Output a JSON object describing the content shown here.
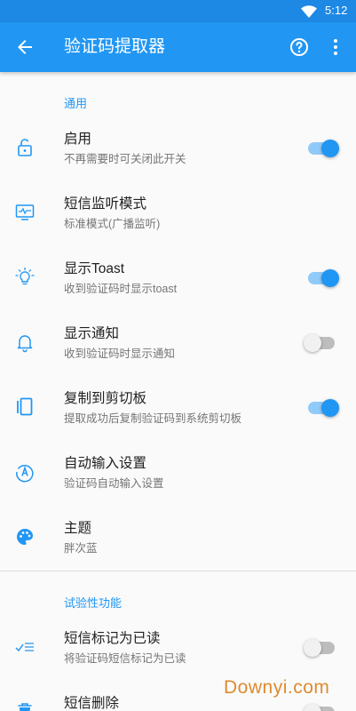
{
  "status_bar": {
    "time": "5:12",
    "wifi_icon": "wifi-icon"
  },
  "app_bar": {
    "title": "验证码提取器",
    "back_icon": "arrow-back-icon",
    "help_icon": "help-circle-icon",
    "more_icon": "more-vert-icon",
    "color": "#2196f3"
  },
  "sections": [
    {
      "header": "通用",
      "items": [
        {
          "title": "启用",
          "subtitle": "不再需要时可关闭此开关",
          "icon": "lock-open-icon",
          "switch": true
        },
        {
          "title": "短信监听模式",
          "subtitle": "标准模式(广播监听)",
          "icon": "monitor-icon"
        },
        {
          "title": "显示Toast",
          "subtitle": "收到验证码时显示toast",
          "icon": "lightbulb-icon",
          "switch": true
        },
        {
          "title": "显示通知",
          "subtitle": "收到验证码时显示通知",
          "icon": "bell-icon",
          "switch": false
        },
        {
          "title": "复制到剪切板",
          "subtitle": "提取成功后复制验证码到系统剪切板",
          "icon": "copy-icon",
          "switch": true
        },
        {
          "title": "自动输入设置",
          "subtitle": "验证码自动输入设置",
          "icon": "auto-input-icon"
        },
        {
          "title": "主题",
          "subtitle": "胖次蓝",
          "icon": "palette-icon"
        }
      ]
    },
    {
      "header": "试验性功能",
      "items": [
        {
          "title": "短信标记为已读",
          "subtitle": "将验证码短信标记为已读",
          "icon": "mark-read-icon",
          "switch": false
        },
        {
          "title": "短信删除",
          "subtitle": "",
          "icon": "delete-icon",
          "switch": false
        }
      ]
    }
  ],
  "watermark": "Downyi.com",
  "colors": {
    "accent": "#2196f3",
    "status_bar": "#1e88e5",
    "switch_track_on": "#90caf9"
  }
}
